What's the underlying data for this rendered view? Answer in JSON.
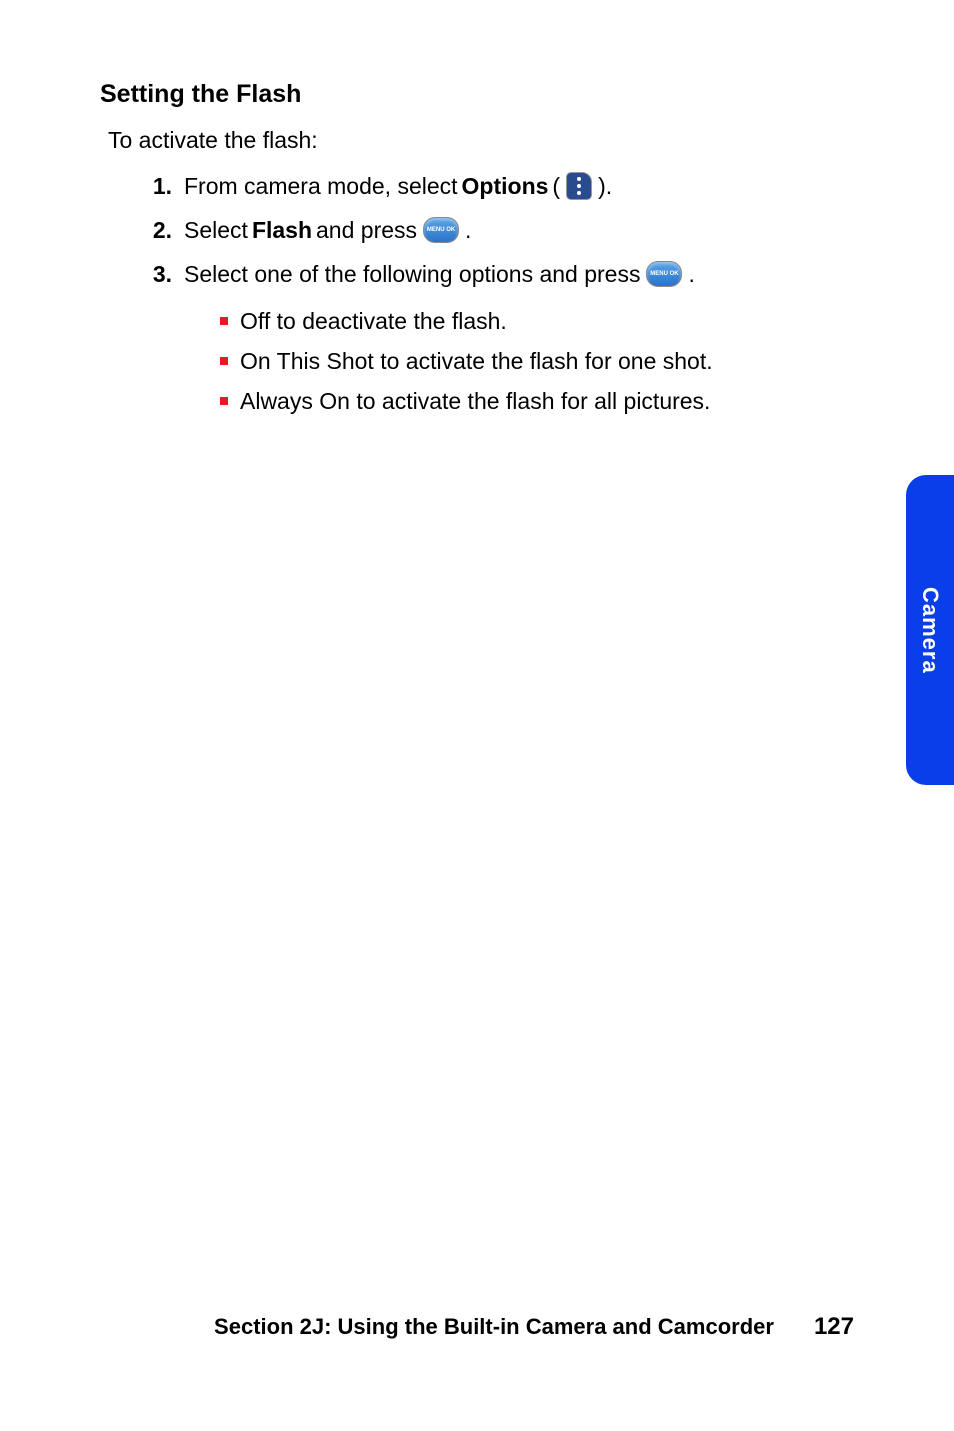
{
  "heading": "Setting the Flash",
  "intro": "To activate the flash:",
  "steps": [
    {
      "num": "1.",
      "prefix": "From camera mode, select ",
      "bold": "Options",
      "open_paren": "(",
      "close_paren": ").",
      "icon": "options"
    },
    {
      "num": "2.",
      "prefix": "Select ",
      "bold": "Flash",
      "mid": " and press ",
      "suffix": ".",
      "icon": "menu-ok"
    },
    {
      "num": "3.",
      "prefix": "Select one of the following options and press ",
      "suffix": ".",
      "icon": "menu-ok"
    }
  ],
  "sub_items": [
    {
      "bold": "Off",
      "rest": " to deactivate the flash."
    },
    {
      "bold": "On This Shot",
      "rest": " to activate the flash for one shot."
    },
    {
      "bold": "Always On",
      "rest": " to activate the flash for all pictures."
    }
  ],
  "side_tab": "Camera",
  "footer_section": "Section 2J: Using the Built-in Camera and Camcorder",
  "footer_page": "127",
  "menu_ok_label": "MENU\nOK"
}
